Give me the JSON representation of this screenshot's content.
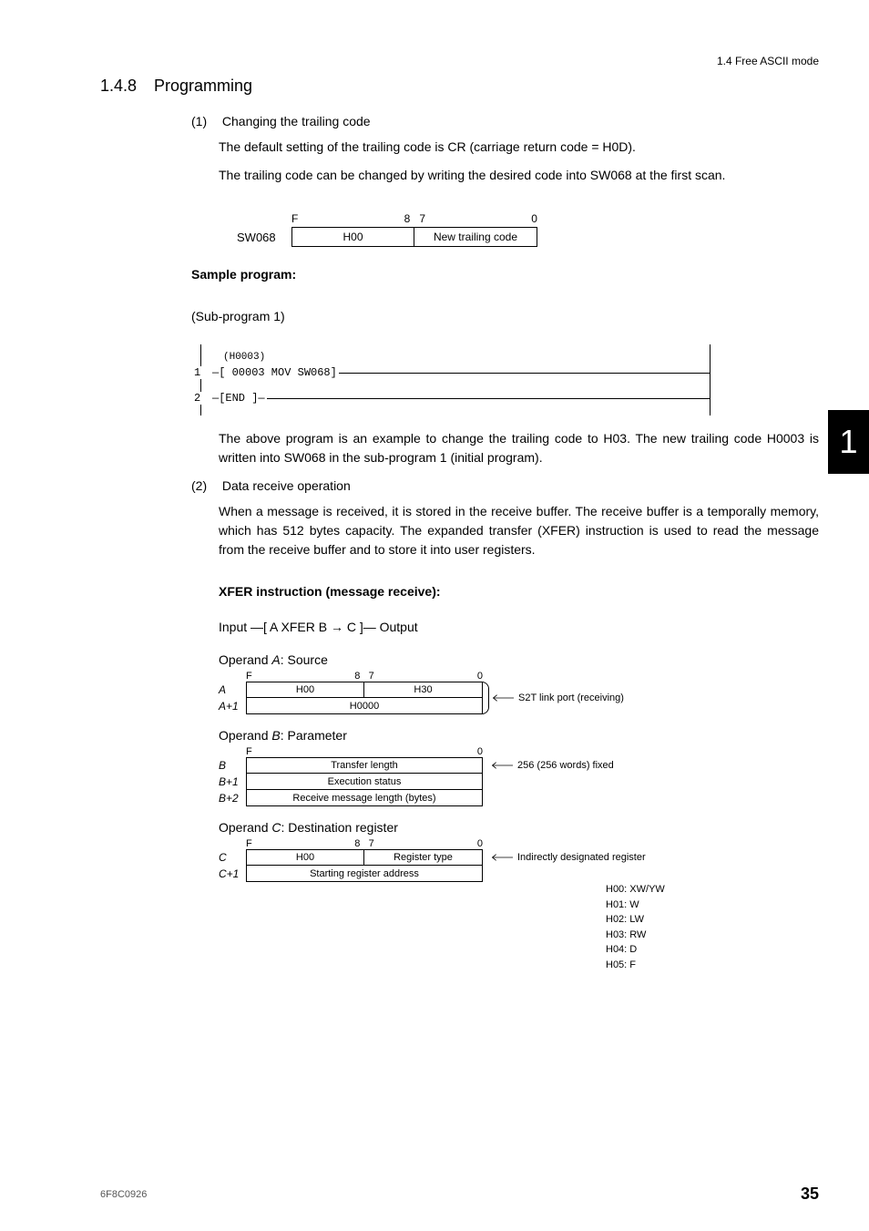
{
  "header": {
    "path": "1.4  Free ASCII mode"
  },
  "section": {
    "number": "1.4.8",
    "title": "Programming"
  },
  "item1": {
    "num": "(1)",
    "title": "Changing the trailing code",
    "p1": "The default setting of the trailing code is CR (carriage return code = H0D).",
    "p2": "The trailing code can be changed by writing the desired code into SW068 at the first scan."
  },
  "sw068": {
    "label": "SW068",
    "bitF": "F",
    "bit87": "8   7",
    "bit0": "0",
    "cell1": "H00",
    "cell2": "New trailing code"
  },
  "sample": {
    "title": "Sample program:",
    "sub": "(Sub-program 1)",
    "comment": "(H0003)",
    "line1_num": "1",
    "line1": "—[ 00003 MOV SW068]",
    "line2_num": "2",
    "line2": "—[END ]—",
    "desc": "The above program is an example to change the trailing code to H03. The new trailing code H0003 is written into SW068 in the sub-program 1 (initial program)."
  },
  "item2": {
    "num": "(2)",
    "title": "Data receive operation",
    "p1": "When a message is received, it is stored in the receive buffer. The receive buffer is a temporally memory, which has 512 bytes capacity. The expanded transfer (XFER) instruction is used to read the message from the receive buffer and to store it into user registers."
  },
  "xfer": {
    "title": "XFER instruction (message receive):",
    "line": "Input —[  A  XFER  B  →  C  ]— Output"
  },
  "opA": {
    "title_pre": "Operand ",
    "letter": "A",
    "title_post": ": Source",
    "bitF": "F",
    "bit87": "8   7",
    "bit0": "0",
    "rowA_label": "A",
    "rowA_c1": "H00",
    "rowA_c2": "H30",
    "rowA1_label": "A+1",
    "rowA1_c": "H0000",
    "note": "S2T link port (receiving)"
  },
  "opB": {
    "title_pre": "Operand ",
    "letter": "B",
    "title_post": ": Parameter",
    "bitF": "F",
    "bit0": "0",
    "rowB_label": "B",
    "rowB_c": "Transfer length",
    "rowB1_label": "B+1",
    "rowB1_c": "Execution status",
    "rowB2_label": "B+2",
    "rowB2_c": "Receive message length (bytes)",
    "note": "256 (256 words) fixed"
  },
  "opC": {
    "title_pre": "Operand ",
    "letter": "C",
    "title_post": ": Destination register",
    "bitF": "F",
    "bit87": "8   7",
    "bit0": "0",
    "rowC_label": "C",
    "rowC_c1": "H00",
    "rowC_c2": "Register type",
    "rowC1_label": "C+1",
    "rowC1_c": "Starting register address",
    "note": "Indirectly designated register",
    "types": [
      "H00: XW/YW",
      "H01: W",
      "H02: LW",
      "H03: RW",
      "H04: D",
      "H05: F"
    ]
  },
  "sideTab": "1",
  "footer": {
    "code": "6F8C0926",
    "page": "35"
  }
}
